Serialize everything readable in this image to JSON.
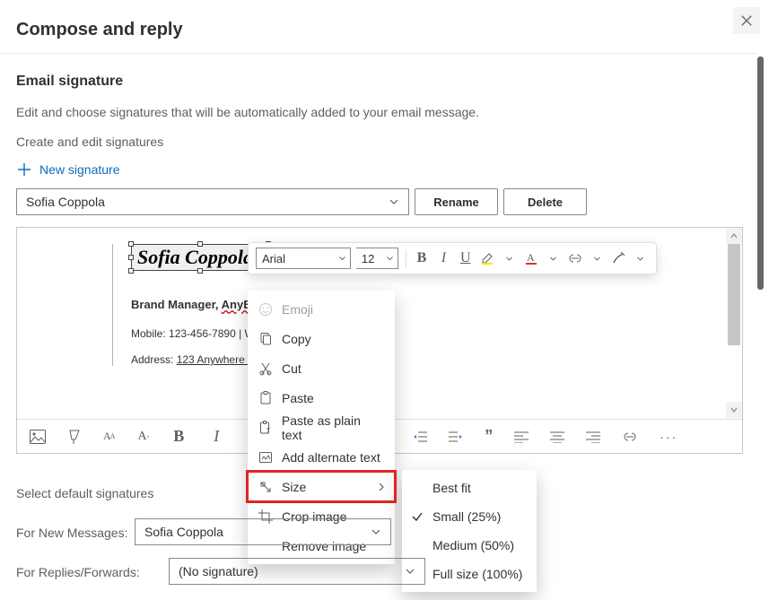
{
  "header": {
    "title": "Compose and reply"
  },
  "section": {
    "heading": "Email signature",
    "description": "Edit and choose signatures that will be automatically added to your email message.",
    "sub": "Create and edit signatures",
    "new_signature_label": "New signature"
  },
  "signature_row": {
    "selected": "Sofia Coppola",
    "rename_label": "Rename",
    "delete_label": "Delete"
  },
  "editor": {
    "signature_name_image": "Sofia Coppola",
    "brand_line_prefix": "Brand Manager, ",
    "brand_company_truncated": "AnyE",
    "mobile_line": "Mobile: 123-456-7890  | We",
    "address_label": "Address:",
    "address_value": "123 Anywhere St,"
  },
  "float_fmt": {
    "font": "Arial",
    "size": "12"
  },
  "context_menu": {
    "items": [
      {
        "label": "Emoji",
        "icon": "emoji-icon",
        "disabled": true
      },
      {
        "label": "Copy",
        "icon": "copy-icon"
      },
      {
        "label": "Cut",
        "icon": "cut-icon"
      },
      {
        "label": "Paste",
        "icon": "paste-icon"
      },
      {
        "label": "Paste as plain text",
        "icon": "paste-plain-icon"
      },
      {
        "label": "Add alternate text",
        "icon": "alt-text-icon"
      },
      {
        "label": "Size",
        "icon": "size-icon",
        "submenu": true,
        "highlighted": true
      },
      {
        "label": "Crop image",
        "icon": "crop-icon"
      },
      {
        "label": "Remove image",
        "icon": ""
      }
    ]
  },
  "size_submenu": {
    "items": [
      {
        "label": "Best fit"
      },
      {
        "label": "Small (25%)",
        "checked": true
      },
      {
        "label": "Medium (50%)"
      },
      {
        "label": "Full size (100%)"
      }
    ]
  },
  "defaults": {
    "heading": "Select default signatures",
    "new_label": "For New Messages:",
    "new_value": "Sofia Coppola",
    "rep_label": "For Replies/Forwards:",
    "rep_value": "(No signature)"
  }
}
